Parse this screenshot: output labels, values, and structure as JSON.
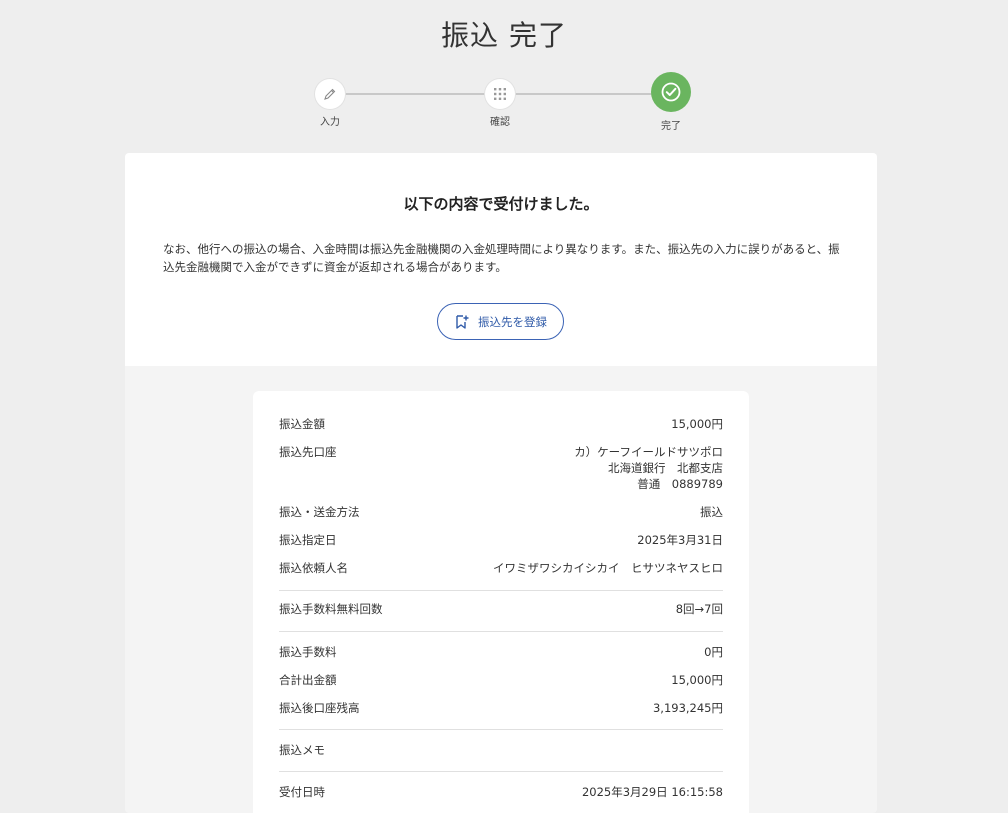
{
  "page": {
    "title": "振込 完了"
  },
  "stepper": {
    "steps": [
      {
        "label": "入力",
        "icon": "pencil-icon"
      },
      {
        "label": "確認",
        "icon": "grid-icon"
      },
      {
        "label": "完了",
        "icon": "check-circle-icon"
      }
    ],
    "done_color": "#6ab55f"
  },
  "message": {
    "heading": "以下の内容で受付けました。",
    "note": "なお、他行への振込の場合、入金時間は振込先金融機関の入金処理時間により異なります。また、振込先の入力に誤りがあると、振込先金融機関で入金ができずに資金が返却される場合があります。"
  },
  "register_button": {
    "label": "振込先を登録",
    "icon": "bookmark-add-icon",
    "color": "#2f5aa8"
  },
  "details": {
    "amount": {
      "label": "振込金額",
      "value": "15,000円"
    },
    "account": {
      "label": "振込先口座",
      "name": "カ）ケーフイールドサツポロ",
      "bank": "北海道銀行　北都支店",
      "number": "普通　0889789"
    },
    "method": {
      "label": "振込・送金方法",
      "value": "振込"
    },
    "date": {
      "label": "振込指定日",
      "value": "2025年3月31日"
    },
    "requester": {
      "label": "振込依頼人名",
      "value": "イワミザワシカイシカイ　ヒサツネヤスヒロ"
    },
    "free_count": {
      "label": "振込手数料無料回数",
      "value": "8回→7回"
    },
    "fee": {
      "label": "振込手数料",
      "value": "0円"
    },
    "total": {
      "label": "合計出金額",
      "value": "15,000円"
    },
    "balance": {
      "label": "振込後口座残高",
      "value": "3,193,245円"
    },
    "memo": {
      "label": "振込メモ",
      "value": ""
    },
    "received": {
      "label": "受付日時",
      "value": "2025年3月29日 16:15:58"
    }
  }
}
